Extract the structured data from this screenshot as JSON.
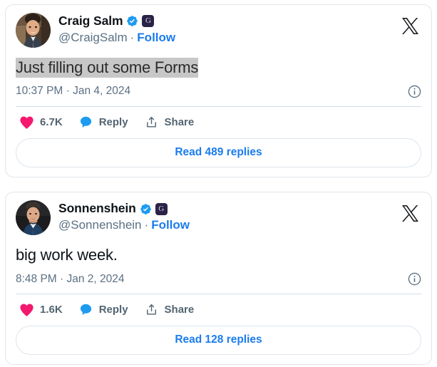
{
  "page": {
    "background": "#ffffff",
    "accent_blue": "#1b7ced",
    "like_pink": "#f4186e",
    "reply_blue": "#1d9bf0",
    "verified_blue": "#1d9bf0",
    "affiliate_bg": "#2b2347",
    "selection_highlight": "#c7c7c7",
    "muted_text": "#5b7083",
    "border": "#dfe6ec"
  },
  "tweets": [
    {
      "id": "tweet-craig-salm",
      "author": {
        "display_name": "Craig Salm",
        "handle": "@CraigSalm",
        "verified": true,
        "verified_icon": "verified-check-icon",
        "affiliate_badge_letter": "G",
        "affiliate_badge_icon": "grayscale-affiliate-badge-icon",
        "avatar_alt": "Craig Salm profile photo"
      },
      "separator": "·",
      "follow_label": "Follow",
      "logo_icon": "x-logo-icon",
      "text": "Just filling out some Forms",
      "text_selected": true,
      "timestamp": "10:37 PM · Jan 4, 2024",
      "info_icon": "info-circle-icon",
      "actions": [
        {
          "name": "like",
          "icon": "heart-icon",
          "label": "6.7K"
        },
        {
          "name": "reply",
          "icon": "reply-bubble-icon",
          "label": "Reply"
        },
        {
          "name": "share",
          "icon": "share-upload-icon",
          "label": "Share"
        }
      ],
      "replies_button_label": "Read 489 replies"
    },
    {
      "id": "tweet-sonnenshein",
      "author": {
        "display_name": "Sonnenshein",
        "handle": "@Sonnenshein",
        "verified": true,
        "verified_icon": "verified-check-icon",
        "affiliate_badge_letter": "G",
        "affiliate_badge_icon": "grayscale-affiliate-badge-icon",
        "avatar_alt": "Sonnenshein profile photo"
      },
      "separator": "·",
      "follow_label": "Follow",
      "logo_icon": "x-logo-icon",
      "text": "big work week.",
      "text_selected": false,
      "timestamp": "8:48 PM · Jan 2, 2024",
      "info_icon": "info-circle-icon",
      "actions": [
        {
          "name": "like",
          "icon": "heart-icon",
          "label": "1.6K"
        },
        {
          "name": "reply",
          "icon": "reply-bubble-icon",
          "label": "Reply"
        },
        {
          "name": "share",
          "icon": "share-upload-icon",
          "label": "Share"
        }
      ],
      "replies_button_label": "Read 128 replies"
    }
  ]
}
